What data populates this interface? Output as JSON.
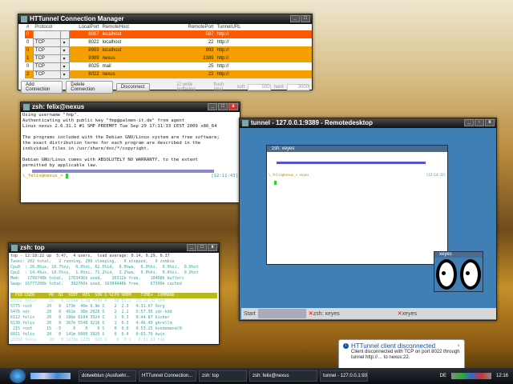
{
  "httunnel": {
    "title": "HTTunnel Connection Manager",
    "columns": [
      "#",
      "Protocol",
      "LocalPort",
      "RemoteHost",
      "RemotePort",
      "TunnelURL"
    ],
    "rows": [
      {
        "n": "0",
        "proto": "TCP",
        "lport": "8087",
        "host": "localhost",
        "rport": "587",
        "url": "http://",
        "style": "red"
      },
      {
        "n": "0",
        "proto": "TCP",
        "lport": "8022",
        "host": "localhost",
        "rport": "22",
        "url": "http://",
        "style": "white"
      },
      {
        "n": "0",
        "proto": "TCP",
        "lport": "8993",
        "host": "localhost",
        "rport": "993",
        "url": "http://",
        "style": "orange"
      },
      {
        "n": "1",
        "proto": "TCP",
        "lport": "9389",
        "host": "nexus",
        "rport": "3389",
        "url": "http://",
        "style": "orange"
      },
      {
        "n": "0",
        "proto": "TCP",
        "lport": "8025",
        "host": "mail",
        "rport": "25",
        "url": "http://",
        "style": "white"
      },
      {
        "n": "2",
        "proto": "TCP",
        "lport": "8022",
        "host": "nexus",
        "rport": "22",
        "url": "http://",
        "style": "orange"
      }
    ],
    "add": "Add Connection",
    "delete": "Delete Connection",
    "disconnect": "Disconnect",
    "write_buffering": "write buffering",
    "flush_label": "flush (ms)",
    "soft_label": "soft",
    "soft": "500",
    "hard_label": "hard",
    "hard": "3000"
  },
  "zsh1": {
    "title": "zsh: felix@nexus",
    "lines": [
      "Using username \"fmp\".",
      "Authenticating with public key \"fmp@palmen-it.de\" from agent",
      "Linux nexus 2.6.31.1 #1 SMP PREEMPT Tue Sep 29 17:11:33 CEST 2009 x86_64",
      "",
      "The programs included with the Debian GNU/Linux system are free software;",
      "the exact distribution terms for each program are described in the",
      "individual files in /usr/share/doc/*/copyright.",
      "",
      "Debian GNU/Linux comes with ABSOLUTELY NO WARRANTY, to the extent",
      "permitted by applicable law."
    ],
    "prompt": "\\_felix@nexus_> ",
    "time": "[12:11:43]"
  },
  "top": {
    "title": "zsh: top",
    "lines": [
      "top - 12:18:22 up  5:47,  4 users,  load average: 0.14, 0.29, 0.37",
      "Tasks: 202 total,   2 running, 200 sleeping,   0 stopped,   0 zombie",
      "Cpu0  : 26.8%us, 10.7%sy,  0.0%ni, 62.5%id,  0.0%wa,  0.0%hi,  0.0%si,  0.0%st",
      "Cpu1  : 14.4%us, 10.5%sy,  1.0%ni, 71.2%id,  2.2%wa,  0.0%hi,  0.6%si,  0.0%st",
      "Mem:   1799748k total,  1763436k used,    36312k free,    10468k buffers",
      "Swap: 16777208k total,   392760k used, 16384448k free,    67300k cached"
    ],
    "header": "  PID USER      PR  NI  VIRT  RES  SHR S %CPU %MEM    TIME+  COMMAND",
    "procs": [
      "20332 felix     20   0 1538m 1.2g 4500 R   58 65.2  23:23.32 vvm",
      "5775 root      20   0  173m  40m 9.9m S    2  2.3   4:31.67 Xorg",
      "5476 sdr       20   0  451m  36m 2028 S    2  2.1   5:57.35 sdr-kdd",
      "6112 felix     20   0  186m 6104 3524 S    1  0.3   0:44.87 kicker",
      "6130 felix     20   0  367m 5548 3216 S    1  0.3   4:46.49 gkrellm",
      " 215 root      15  -5     0    0    0 S    0  0.0   0:53.25 kondemand/0",
      "6011 felix     20   0  141m 6600 3920 S    0  0.4   0:03.76 kwin",
      "21081 felix     20   0 1073m 1236  920 S    0  0.1   0:01.01 top"
    ]
  },
  "rdp": {
    "title": "tunnel - 127.0.0.1:9389 - Remotedesktop",
    "xterm_title": "zsh: xeyes",
    "xterm_prompt": "\\_felix@nexus_> xeyes",
    "xterm_time": "[12:14:32]",
    "xeyes_title": "xeyes",
    "start": "Start",
    "task1": "zsh: xeyes",
    "task2": "xeyes",
    "bg": "#3f7fb5"
  },
  "notify": {
    "title": "HTTunnel client disconnected",
    "body": "Client disconnected with TCP on port 8022 through tunnel http://… to nexus:22."
  },
  "taskbar": {
    "items": [
      "dotwebtun (Ausfuehr...",
      "HTTunnel Connection...",
      "zsh: top",
      "zsh: felix@nexus",
      "tunnel - 127.0.0.1:938..."
    ],
    "lang": "DE",
    "clock": "12:16"
  }
}
